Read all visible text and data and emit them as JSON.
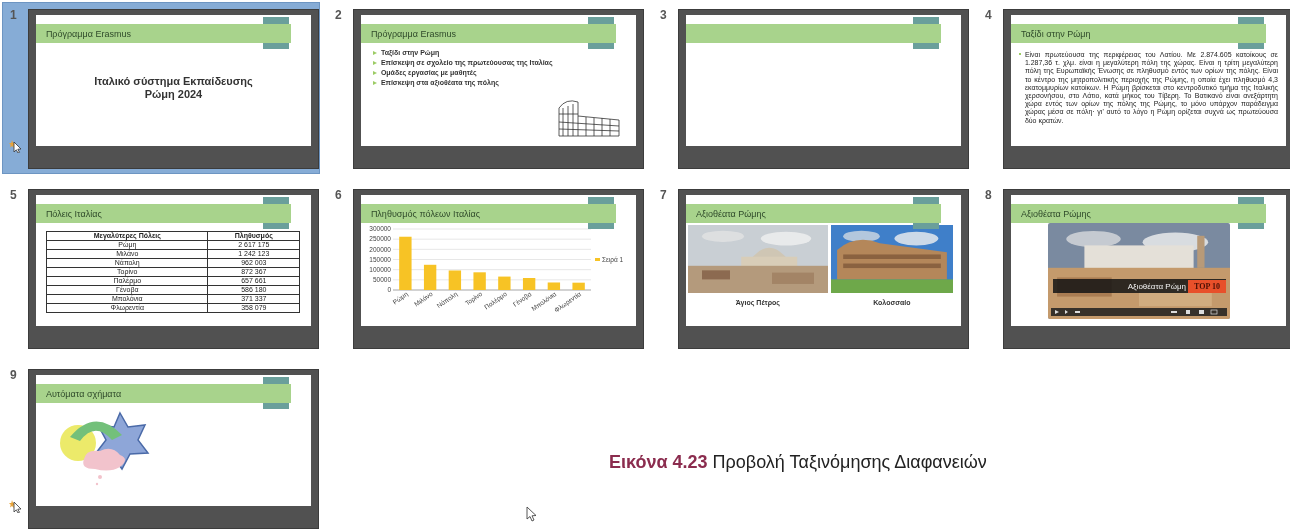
{
  "slides": [
    {
      "number": "1",
      "selected": true,
      "animated": true,
      "kind": "title",
      "title": "Πρόγραμμα Erasmus",
      "lines": [
        "Ιταλικό σύστημα Εκπαίδευσης",
        "Ρώμη 2024"
      ]
    },
    {
      "number": "2",
      "selected": false,
      "animated": false,
      "kind": "bullets",
      "title": "Πρόγραμμα Erasmus",
      "bullets": [
        "Ταξίδι στην Ρώμη",
        "Επίσκεψη σε σχολείο της πρωτεύουσας της Ιταλίας",
        "Ομάδες εργασίας με μαθητές",
        "Επίσκεψη στα αξιοθέατα της πόλης"
      ]
    },
    {
      "number": "3",
      "selected": false,
      "animated": false,
      "kind": "blank"
    },
    {
      "number": "4",
      "selected": false,
      "animated": false,
      "kind": "text",
      "title": "Ταξίδι στην Ρώμη",
      "paragraph": "Είναι πρωτεύουσα της περιφέρειας του Λατίου. Με 2.874.605 κατοίκους σε 1.287,36 τ. χλμ. είναι η μεγαλύτερη πόλη της χώρας. Είναι η τρίτη μεγαλύτερη πόλη της Ευρωπαϊκής Ένωσης σε πληθυσμό εντός των ορίων της πόλης. Είναι το κέντρο της μητροπολιτικής περιοχής της Ρώμης, η οποία έχει πληθυσμό 4,3 εκατομμυρίων κατοίκων. Η Ρώμη βρίσκεται στο κεντροδυτικό τμήμα της Ιταλικής χερσονήσου, στο Λάτιο, κατά μήκος του Τίβερη. Το Βατικανό είναι ανεξάρτητη χώρα εντός των ορίων της πόλης της Ρώμης, το μόνο υπάρχον παράδειγμα χώρας μέσα σε πόλη· γι' αυτό το λόγο η Ρώμη ορίζεται συχνά ως πρωτεύουσα δύο κρατών."
    },
    {
      "number": "5",
      "selected": false,
      "animated": false,
      "kind": "table",
      "title": "Πόλεις Ιταλίας",
      "table": {
        "columns": [
          "Μεγαλύτερες Πόλεις",
          "Πληθυσμός"
        ],
        "rows": [
          [
            "Ρώμη",
            "2 617 175"
          ],
          [
            "Μιλάνο",
            "1 242 123"
          ],
          [
            "Νάπολη",
            "962 003"
          ],
          [
            "Τορίνο",
            "872 367"
          ],
          [
            "Παλέρμο",
            "657 661"
          ],
          [
            "Γένοβα",
            "586 180"
          ],
          [
            "Μπολόνια",
            "371 337"
          ],
          [
            "Φλωρεντία",
            "358 079"
          ]
        ]
      }
    },
    {
      "number": "6",
      "selected": false,
      "animated": false,
      "kind": "chart",
      "title": "Πληθυσμός πόλεων Ιταλίας",
      "chart_data": {
        "type": "bar",
        "categories": [
          "Ρώμη",
          "Μιλάνο",
          "Νάπολη",
          "Τορίνο",
          "Παλέρμο",
          "Γένοβα",
          "Μπολόνια",
          "Φλωρεντία"
        ],
        "series": [
          {
            "name": "Σειρά 1",
            "color": "#f7c325",
            "values": [
              262000,
              124000,
              96000,
              87000,
              66000,
              59000,
              37000,
              36000
            ]
          }
        ],
        "grid": true,
        "ylim": [
          0,
          300000
        ],
        "yticks": [
          0,
          50000,
          100000,
          150000,
          200000,
          250000,
          300000
        ]
      }
    },
    {
      "number": "7",
      "selected": false,
      "animated": false,
      "kind": "photos",
      "title": "Αξιοθέατα Ρώμης",
      "photos": [
        {
          "kind": "picture",
          "caption": "Άγιος Πέτρος"
        },
        {
          "kind": "picture",
          "caption": "Κολοσσαίο"
        }
      ]
    },
    {
      "number": "8",
      "selected": false,
      "animated": false,
      "kind": "video",
      "title": "Αξιοθέατα Ρώμης",
      "video": {
        "kind": "picture",
        "overlay_text": "Αξιοθέατα Ρώμη",
        "badge": "TOP 10"
      }
    },
    {
      "number": "9",
      "selected": false,
      "animated": true,
      "kind": "shapes",
      "title": "Αυτόματα σχήματα"
    }
  ],
  "caption": {
    "label": "Εικόνα 4.23",
    "text": "Προβολή Ταξινόμησης Διαφανειών"
  }
}
